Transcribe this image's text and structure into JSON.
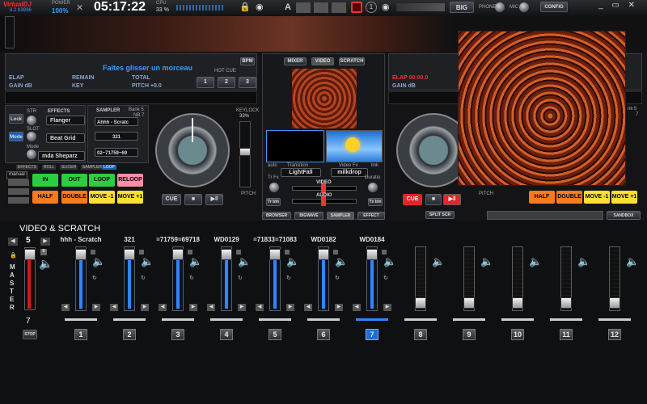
{
  "top": {
    "logo": "VirtualDJ",
    "version": "8.2 b3936",
    "power_label": "POWER",
    "power_value": "100%",
    "clock": "05:17:22",
    "cpu_label": "CPU",
    "cpu_value": "33 %",
    "mode_letter": "A",
    "num_1": "1",
    "big_label": "BIG",
    "phone_label": "PHONE",
    "mic_label": "MIC",
    "config_label": "CONFIG"
  },
  "deck_left": {
    "track_title": "Faites glisser un morceau",
    "elap": "ELAP",
    "remain": "REMAIN",
    "total": "TOTAL",
    "gain": "GAIN dB",
    "key": "KEY",
    "pitch": "PITCH +0.0",
    "bpm": "BPM",
    "hot_cue": "HOT CUE",
    "hot_cue_buttons": [
      "1",
      "2",
      "3"
    ],
    "str": "STR",
    "effects_label": "EFFECTS",
    "effect_1": "Flanger",
    "effect_2": "Beat Grid",
    "effect_3": "mda Sheparz",
    "lock": "Lock",
    "slot": "SLOT",
    "mode": "Mode",
    "sampler_label": "SAMPLER",
    "bank": "Bank 5",
    "nb": "NB 7",
    "sample_1": "Ahhh - Scratc",
    "sample_2": "321",
    "sample_3": "02~71759~69",
    "manual": "manual l",
    "keylock_label": "KEYLOCK",
    "keylock_value": "33%",
    "pitch_label": "PITCH",
    "tabs": [
      "EFFECTS",
      "ROLL",
      "SLICER",
      "SAMPLER",
      "LOOP"
    ],
    "pads": [
      "IN",
      "OUT",
      "LOOP",
      "RELOOP",
      "HALF",
      "DOUBLE",
      "MOVE -1",
      "MOVE +1"
    ],
    "cue": "CUE",
    "bpm_counter": "BPM"
  },
  "center": {
    "tabs": [
      "MIXER",
      "VIDEO",
      "SCRATCH"
    ],
    "auto": "auto",
    "transition_label": "Transition",
    "transition_value": "LightFall",
    "videofx_label": "Video Fx",
    "videofx_value": "milkdrop",
    "link": "link",
    "trfx": "Tr Fx",
    "duration": "Duratio",
    "video_label": "VIDEO",
    "audio_label": "AUDIO",
    "tr_btn_left": "Tr btn",
    "tr_btn_right": "Tx btn",
    "bottom_tabs": [
      "BROWSER",
      "BIGWAVE",
      "SAMPLER",
      "EFFECT"
    ],
    "split": "SPLIT SCR"
  },
  "deck_right": {
    "elap": "ELAP 00:00.0",
    "gain": "GAIN dB",
    "pads": [
      "HALF",
      "DOUBLE",
      "MOVE -1",
      "MOVE +1"
    ],
    "cue": "CUE",
    "pitch": "PITCH",
    "bank": "nk 5",
    "nb": "7",
    "sandbox": "SANDBOX"
  },
  "scratch": {
    "title": "VIDEO & SCRATCH",
    "master_value": "5",
    "master_label": "MASTER",
    "master_num": "7",
    "stop": "STOP",
    "channels": [
      {
        "name": "hhh - Scratch",
        "num": "1"
      },
      {
        "name": "321",
        "num": "2"
      },
      {
        "name": "=71759=69718",
        "num": "3"
      },
      {
        "name": "WD0129",
        "num": "4"
      },
      {
        "name": "=71833=71083",
        "num": "5"
      },
      {
        "name": "WD0182",
        "num": "6"
      },
      {
        "name": "WD0184",
        "num": "7"
      },
      {
        "name": "",
        "num": "8"
      },
      {
        "name": "",
        "num": "9"
      },
      {
        "name": "",
        "num": "10"
      },
      {
        "name": "",
        "num": "11"
      },
      {
        "name": "",
        "num": "12"
      }
    ],
    "active_channel": "7"
  },
  "colors": {
    "accent_blue": "#2f86ff",
    "pad_green": "#2ecc40",
    "pad_orange": "#ff7a1a",
    "pad_yellow": "#ffe030",
    "pad_pink": "#ff8fa8",
    "cue_red": "#e8222a"
  }
}
